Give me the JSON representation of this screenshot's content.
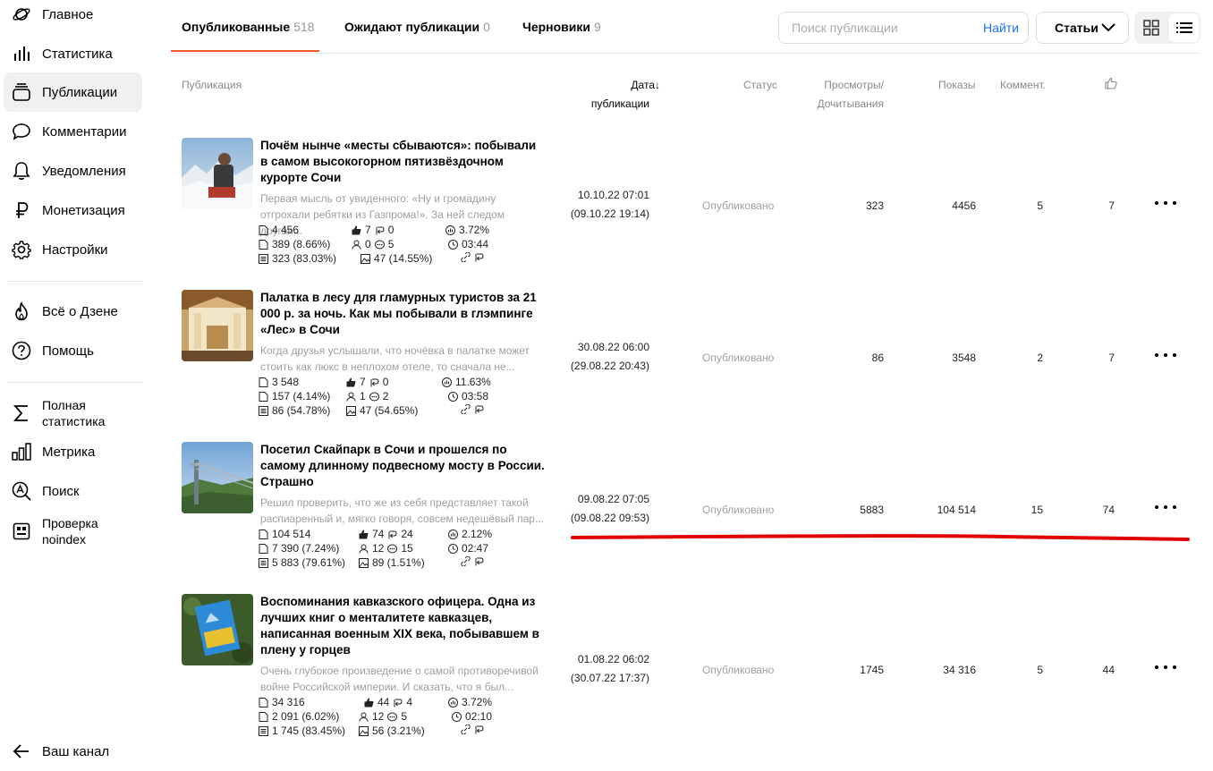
{
  "sidebar": {
    "items": [
      {
        "label": "Главное",
        "icon": "planet-icon"
      },
      {
        "label": "Статистика",
        "icon": "bar-chart-icon"
      },
      {
        "label": "Публикации",
        "icon": "stack-icon"
      },
      {
        "label": "Комментарии",
        "icon": "comment-icon"
      },
      {
        "label": "Уведомления",
        "icon": "bell-icon"
      },
      {
        "label": "Монетизация",
        "icon": "ruble-icon"
      },
      {
        "label": "Настройки",
        "icon": "gear-icon"
      }
    ],
    "secondary": [
      {
        "label": "Всё о Дзене",
        "icon": "flame-icon"
      },
      {
        "label": "Помощь",
        "icon": "help-icon"
      }
    ],
    "tools": [
      {
        "label_line1": "Полная",
        "label_line2": "статистика",
        "icon": "sigma-icon"
      },
      {
        "label": "Метрика",
        "icon": "metrics-icon"
      },
      {
        "label": "Поиск",
        "icon": "search-a-icon"
      },
      {
        "label_line1": "Проверка",
        "label_line2": "noindex",
        "icon": "noindex-icon"
      }
    ],
    "back": {
      "label": "Ваш канал",
      "icon": "back-arrow-icon"
    }
  },
  "tabs": [
    {
      "label": "Опубликованные",
      "count": "518",
      "active": true
    },
    {
      "label": "Ожидают публикации",
      "count": "0"
    },
    {
      "label": "Черновики",
      "count": "9"
    }
  ],
  "search": {
    "placeholder": "Поиск публикации",
    "button": "Найти"
  },
  "type_select": {
    "value": "Статьи"
  },
  "columns": {
    "publication": "Публикация",
    "date_line1": "Дата↓",
    "date_line2": "публикации",
    "status": "Статус",
    "views_line1": "Просмотры/",
    "views_line2": "Дочитывания",
    "impressions": "Показы",
    "comments": "Коммент."
  },
  "rows": [
    {
      "title": "Почём нынче «месты сбываются»: побывали в самом высокогорном пятизвёздочном курорте Сочи",
      "snippet": "Первая мысль от увиденного: «Ну и громадину отгрохали ребятки из Газпрома!». За ней следом другая...",
      "stats": {
        "impr": "4 456",
        "views": "389 (8.66%)",
        "reads": "323 (83.03%)",
        "likes": "7",
        "reposts": "0",
        "subs": "0",
        "comments": "5",
        "ctr": "3.72%",
        "time": "03:44",
        "photo": "47 (14.55%)"
      },
      "date": "10.10.22 07:01",
      "date2": "(09.10.22 19:14)",
      "status": "Опубликовано",
      "views": "323",
      "impressions": "4456",
      "comments": "5",
      "likes": "7"
    },
    {
      "title": "Палатка в лесу для гламурных туристов за 21 000 р. за ночь. Как мы побывали в глэмпинге «Лес» в Сочи",
      "snippet": "Когда друзья услышали, что ночёвка в палатке может стоить как люкс в неплохом отеле, то сначала не...",
      "stats": {
        "impr": "3 548",
        "views": "157 (4.14%)",
        "reads": "86 (54.78%)",
        "likes": "7",
        "reposts": "0",
        "subs": "1",
        "comments": "2",
        "ctr": "11.63%",
        "time": "03:58",
        "photo": "47 (54.65%)"
      },
      "date": "30.08.22 06:00",
      "date2": "(29.08.22 20:43)",
      "status": "Опубликовано",
      "views": "86",
      "impressions": "3548",
      "comments": "2",
      "likes": "7"
    },
    {
      "title": "Посетил Скайпарк в Сочи и прошелся по самому длинному подвесному мосту в России. Страшно",
      "snippet": "Решил проверить, что же из себя представляет такой распиаренный и, мягко говоря, совсем недешёвый пар...",
      "stats": {
        "impr": "104 514",
        "views": "7 390 (7.24%)",
        "reads": "5 883 (79.61%)",
        "likes": "74",
        "reposts": "24",
        "subs": "12",
        "comments": "15",
        "ctr": "2.12%",
        "time": "02:47",
        "photo": "89 (1.51%)"
      },
      "date": "09.08.22 07:05",
      "date2": "(09.08.22 09:53)",
      "status": "Опубликовано",
      "views": "5883",
      "impressions": "104 514",
      "comments": "15",
      "likes": "74"
    },
    {
      "title": "Воспоминания кавказского офицера. Одна из лучших книг о менталитете кавказцев, написанная военным XIX века, побывавшем в плену у горцев",
      "snippet": "Очень глубокое произведение о самой противоречивой войне Российской империи. И сказать, что я был...",
      "stats": {
        "impr": "34 316",
        "views": "2 091 (6.02%)",
        "reads": "1 745 (83.45%)",
        "likes": "44",
        "reposts": "4",
        "subs": "12",
        "comments": "5",
        "ctr": "3.72%",
        "time": "02:10",
        "photo": "56 (3.21%)"
      },
      "date": "01.08.22 06:02",
      "date2": "(30.07.22 17:37)",
      "status": "Опубликовано",
      "views": "1745",
      "impressions": "34 316",
      "comments": "5",
      "likes": "44"
    }
  ],
  "annotation_color": "#e00000",
  "accent_color": "#f05a28",
  "link_color": "#1e73e8"
}
